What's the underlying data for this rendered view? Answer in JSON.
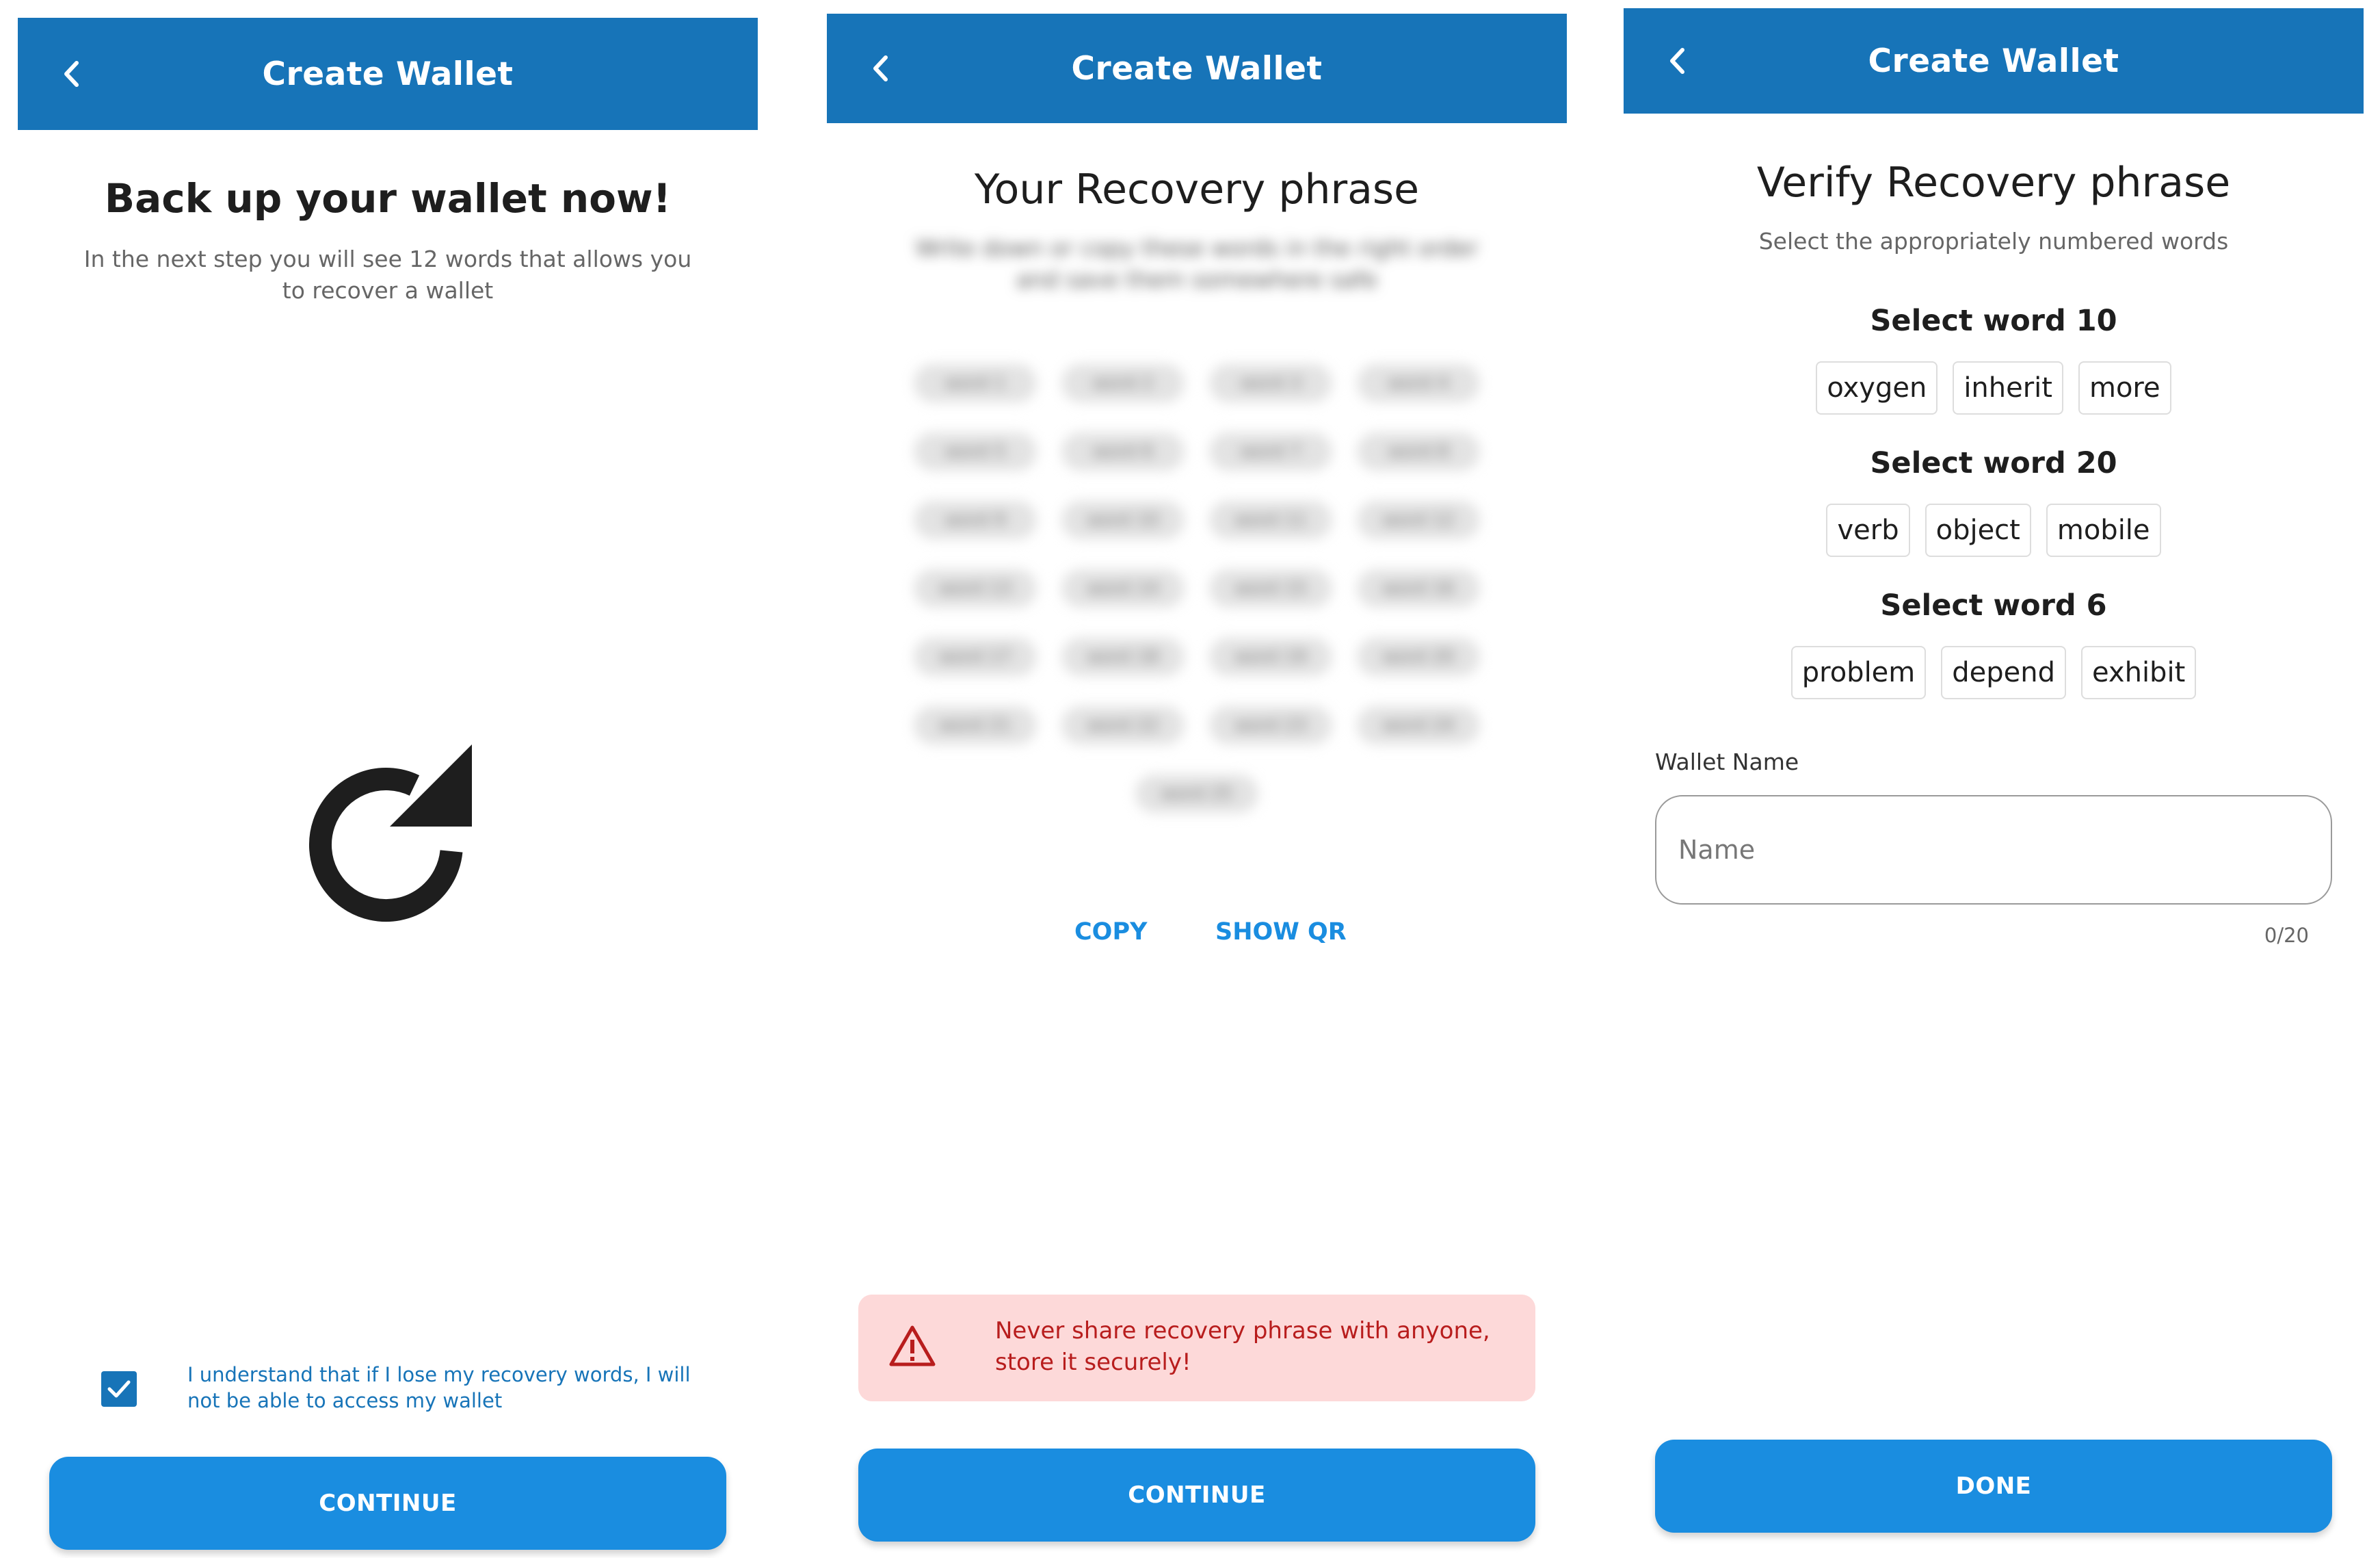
{
  "screens": [
    {
      "appbar_title": "Create Wallet",
      "heading": "Back up your wallet now!",
      "description": "In the next step you will see 12 words that allows you to recover a wallet",
      "checkbox_checked": true,
      "checkbox_label": "I understand that if I lose my recovery words, I will not be able to access my wallet",
      "button_label": "CONTINUE",
      "icon": "refresh-icon"
    },
    {
      "appbar_title": "Create Wallet",
      "heading": "Your Recovery phrase",
      "blurred_intro": "Write down or copy these words in the right order and save them somewhere safe",
      "blurred_words": [
        "word 1",
        "word 2",
        "word 3",
        "word 4",
        "word 5",
        "word 6",
        "word 7",
        "word 8",
        "word 9",
        "word 10",
        "word 11",
        "word 12",
        "word 13",
        "word 14",
        "word 15",
        "word 16",
        "word 17",
        "word 18",
        "word 19",
        "word 20",
        "word 21",
        "word 22",
        "word 23",
        "word 24",
        "word 25"
      ],
      "copy_label": "COPY",
      "show_qr_label": "SHOW QR",
      "warning_text": "Never share recovery phrase with anyone, store it securely!",
      "button_label": "CONTINUE"
    },
    {
      "appbar_title": "Create Wallet",
      "heading": "Verify Recovery phrase",
      "description": "Select the appropriately numbered words",
      "groups": [
        {
          "label": "Select word 10",
          "options": [
            "oxygen",
            "inherit",
            "more"
          ]
        },
        {
          "label": "Select word 20",
          "options": [
            "verb",
            "object",
            "mobile"
          ]
        },
        {
          "label": "Select word 6",
          "options": [
            "problem",
            "depend",
            "exhibit"
          ]
        }
      ],
      "wallet_name_label": "Wallet Name",
      "wallet_name_placeholder": "Name",
      "wallet_name_value": "",
      "char_counter": "0/20",
      "button_label": "DONE"
    }
  ],
  "colors": {
    "appbar": "#1774b8",
    "primary_button": "#1a8de0",
    "link": "#1a8de0",
    "warning_bg": "#fdd9d9",
    "warning_text": "#b81d1d"
  }
}
